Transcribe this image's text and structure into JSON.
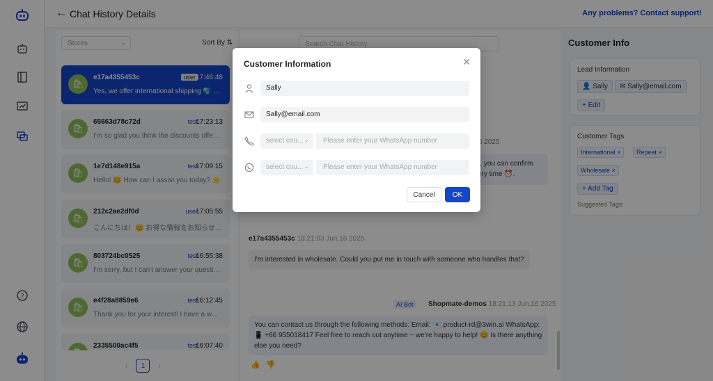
{
  "rail": {
    "icons": [
      "bot-logo-icon",
      "robot-icon",
      "book-icon",
      "chart-icon",
      "chat-icon",
      "help-icon",
      "globe-icon",
      "bot-avatar-icon"
    ]
  },
  "header": {
    "title": "Chat History Details",
    "support_link": "Any problems? Contact support!"
  },
  "list": {
    "stores_placeholder": "Stores",
    "sort_label": "Sort By",
    "conversations": [
      {
        "id": "e17a4355453c",
        "role": "user",
        "time": "17:46:48",
        "snippet": "Yes, we offer international shipping 🌏 to..."
      },
      {
        "id": "65663d78c72d",
        "role": "test",
        "time": "17:23:13",
        "snippet": "I'm so glad you think the discounts offere..."
      },
      {
        "id": "1e7d148e915a",
        "role": "test",
        "time": "17:09:15",
        "snippet": "Hello! 😊 How can I assist you today? 🌟"
      },
      {
        "id": "212c2ae2df0d",
        "role": "user",
        "time": "17:05:55",
        "snippet": "こんにちは！😊 お得な情報をお知らせ..."
      },
      {
        "id": "803724bc0525",
        "role": "test",
        "time": "16:55:38",
        "snippet": "I'm sorry, but I can't answer your question..."
      },
      {
        "id": "e4f28a8859e6",
        "role": "test",
        "time": "16:12:45",
        "snippet": "Thank you for your interest! I have a won..."
      },
      {
        "id": "2335500ac4f5",
        "role": "test",
        "time": "16:07:40",
        "snippet": ""
      }
    ],
    "page": "1"
  },
  "chat": {
    "search_placeholder": "Search Chat History",
    "bot_meta_partial": "s 17:46:48 Jun,16 2025",
    "bot_bubble_1": "ut, you can confirm",
    "bot_bubble_2": "very time ⏰.",
    "user_id": "e17a4355453c",
    "user_time": "18:21:03 Jun,16 2025",
    "user_message": "I'm interested in wholesale. Could you put me in touch with someone who handles that?",
    "ai_badge": "AI Bot",
    "bot_name": "Shopmate-demos",
    "bot_time": "18:21:13 Jun,16 2025",
    "bot_message": "You can contact us through the following methods: Email: 📧 product-rd@3win.ai WhatsApp: 📱 +66 955018417 Feel free to reach out anytime ~ we're happy to help! 😊 Is there anything else you need?"
  },
  "info": {
    "title": "Customer Info",
    "lead_title": "Lead Information",
    "lead_name": "Sally",
    "lead_email": "Sally@email.com",
    "edit_label": "Edit",
    "tags_title": "Customer Tags",
    "tags": [
      "International",
      "Repeat",
      "Wholesale"
    ],
    "add_tag_label": "Add Tag",
    "suggested_label": "Suggested Tags:"
  },
  "modal": {
    "title": "Customer Information",
    "name_value": "Sally",
    "email_value": "Sally@email.com",
    "country_placeholder": "select cou...",
    "whatsapp_placeholder": "Please enter your WhatsApp number",
    "cancel_label": "Cancel",
    "ok_label": "OK"
  },
  "colors": {
    "accent": "#1446c8",
    "avatar": "#8cc05a"
  }
}
